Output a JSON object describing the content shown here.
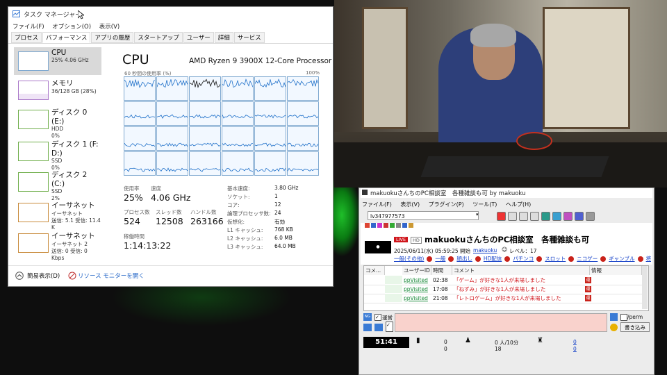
{
  "task_manager": {
    "title": "タスク マネージャー",
    "menu": [
      "ファイル(F)",
      "オプション(O)",
      "表示(V)"
    ],
    "tabs": [
      "プロセス",
      "パフォーマンス",
      "アプリの履歴",
      "スタートアップ",
      "ユーザー",
      "詳細",
      "サービス"
    ],
    "active_tab": "パフォーマンス",
    "sidebar": [
      {
        "name": "CPU",
        "line1": "25%  4.06 GHz",
        "line2": "",
        "line3": ""
      },
      {
        "name": "メモリ",
        "line1": "36/128 GB (28%)",
        "line2": "",
        "line3": ""
      },
      {
        "name": "ディスク 0 (E:)",
        "line1": "HDD",
        "line2": "0%",
        "line3": ""
      },
      {
        "name": "ディスク 1 (F: D:)",
        "line1": "SSD",
        "line2": "0%",
        "line3": ""
      },
      {
        "name": "ディスク 2 (C:)",
        "line1": "SSD",
        "line2": "2%",
        "line3": ""
      },
      {
        "name": "イーサネット",
        "line1": "イーサネット",
        "line2": "送信: 5.1  受信: 11.4 K",
        "line3": ""
      },
      {
        "name": "イーサネット",
        "line1": "イーサネット 2",
        "line2": "送信: 0  受信: 0 Kbps",
        "line3": ""
      }
    ],
    "cpu": {
      "heading": "CPU",
      "model": "AMD Ryzen 9 3900X 12-Core Processor",
      "graph_caption": "60 秒間の使用率 (%)",
      "graph_max": "100%",
      "usage_label": "使用率",
      "usage_value": "25%",
      "speed_label": "速度",
      "speed_value": "4.06 GHz",
      "processes_label": "プロセス数",
      "processes_value": "524",
      "threads_label": "スレッド数",
      "threads_value": "12508",
      "handles_label": "ハンドル数",
      "handles_value": "263166",
      "uptime_label": "稼働時間",
      "uptime_value": "1:14:13:22",
      "specs": [
        {
          "label": "基本速度:",
          "value": "3.80 GHz"
        },
        {
          "label": "ソケット:",
          "value": "1"
        },
        {
          "label": "コア:",
          "value": "12"
        },
        {
          "label": "論理プロセッサ数:",
          "value": "24"
        },
        {
          "label": "仮想化:",
          "value": "有効"
        },
        {
          "label": "L1 キャッシュ:",
          "value": "768 KB"
        },
        {
          "label": "L2 キャッシュ:",
          "value": "6.0 MB"
        },
        {
          "label": "L3 キャッシュ:",
          "value": "64.0 MB"
        }
      ]
    },
    "footer": {
      "fewer_details": "簡易表示(D)",
      "resource_monitor": "リソース モニターを開く"
    }
  },
  "nico": {
    "window_title": "makuokuさんちのPC相談室　各種雑談も可 by makuoku",
    "menu": [
      "ファイル(F)",
      "表示(V)",
      "プラグイン(P)",
      "ツール(T)",
      "ヘルプ(H)"
    ],
    "live_id": "lv347977573",
    "live_badge": "LIVE",
    "hd_badge": "HD",
    "stream_title": "makuokuさんちのPC相談室　各種雑談も可",
    "start_time": "2025/06/11(水) 05:59:25 開始",
    "owner": "makuoku",
    "level": "レベル：17",
    "tags": [
      "一般(その他)",
      "一般",
      "顔出し",
      "HD配信",
      "パチンコ",
      "スロット",
      "ニコゲー",
      "ギャンブル",
      "将"
    ],
    "table_headers": [
      "コメ...",
      "ユーザーID",
      "時間",
      "コメント",
      "情報"
    ],
    "rows": [
      {
        "user": "ppVisited",
        "time": "02:38",
        "comment": "「ゲーム」が好きな1人が来場しました",
        "info": "運"
      },
      {
        "user": "ppVisited",
        "time": "17:08",
        "comment": "「ねずみ」が好きな1人が来場しました",
        "info": "運"
      },
      {
        "user": "ppVisited",
        "time": "21:08",
        "comment": "「レトロゲーム」が好きな1人が来場しました",
        "info": "運"
      }
    ],
    "operator_label": "運営",
    "perm_label": "/perm",
    "submit_label": "書き込み",
    "elapsed": "51:41",
    "stat_a1": "0",
    "stat_a2": "0",
    "stat_b1": "0 人/10分",
    "stat_b2": "18",
    "stat_c1": "0",
    "stat_c2": "0"
  }
}
